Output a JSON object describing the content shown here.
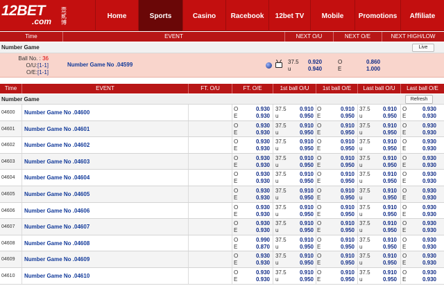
{
  "brand": {
    "logo_text": "12BET",
    "logo_sub": ".com",
    "logo_cn": "壹貳博"
  },
  "nav": {
    "items": [
      {
        "label": "Home",
        "active": false
      },
      {
        "label": "Sports",
        "active": true
      },
      {
        "label": "Casino",
        "active": false
      },
      {
        "label": "Racebook",
        "active": false
      },
      {
        "label": "12bet TV",
        "active": false
      },
      {
        "label": "Mobile",
        "active": false
      },
      {
        "label": "Promotions",
        "active": false
      },
      {
        "label": "Affiliate",
        "active": false
      }
    ]
  },
  "live": {
    "headers": {
      "time": "Time",
      "event": "EVENT",
      "next_ou": "NEXT O/U",
      "next_oe": "NEXT O/E",
      "next_highlow": "NEXT HIGH/LOW"
    },
    "league": "Number Game",
    "live_button": "Live",
    "ball_label": "Ball No. :",
    "ball_no": "36",
    "ou_label": "O/U:",
    "ou_value": "[1-1]",
    "oe_label": "O/E:",
    "oe_value": "[1-1]",
    "game": "Number Game No .04599",
    "line": "37.5",
    "under": "u",
    "over_odds": "0.920",
    "under_odds": "0.940",
    "odd_key": "O",
    "even_key": "E",
    "odd_odds": "0.860",
    "even_odds": "1.000"
  },
  "table": {
    "headers": {
      "time": "Time",
      "event": "EVENT",
      "ft_ou": "FT. O/U",
      "ft_oe": "FT. O/E",
      "first_ou": "1st ball O/U",
      "first_oe": "1st ball O/E",
      "last_ou": "Last ball O/U",
      "last_oe": "Last ball O/E"
    },
    "league": "Number Game",
    "refresh_button": "Refresh",
    "rows": [
      {
        "time": "04600",
        "event": "Number Game No .04600",
        "ft_o": "0.930",
        "ft_e": "0.930",
        "fb_line": "37.5",
        "fb_u": "u",
        "fb_ou1": "0.910",
        "fb_ou2": "0.950",
        "fb_oe1": "0.910",
        "fb_oe2": "0.950",
        "lb_line": "37.5",
        "lb_u": "u",
        "lb_ou1": "0.910",
        "lb_ou2": "0.950",
        "lb_oe1": "0.930",
        "lb_oe2": "0.930"
      },
      {
        "time": "04601",
        "event": "Number Game No .04601",
        "ft_o": "0.930",
        "ft_e": "0.930",
        "fb_line": "37.5",
        "fb_u": "u",
        "fb_ou1": "0.910",
        "fb_ou2": "0.950",
        "fb_oe1": "0.910",
        "fb_oe2": "0.950",
        "lb_line": "37.5",
        "lb_u": "u",
        "lb_ou1": "0.910",
        "lb_ou2": "0.950",
        "lb_oe1": "0.930",
        "lb_oe2": "0.930"
      },
      {
        "time": "04602",
        "event": "Number Game No .04602",
        "ft_o": "0.930",
        "ft_e": "0.930",
        "fb_line": "37.5",
        "fb_u": "u",
        "fb_ou1": "0.910",
        "fb_ou2": "0.950",
        "fb_oe1": "0.910",
        "fb_oe2": "0.950",
        "lb_line": "37.5",
        "lb_u": "u",
        "lb_ou1": "0.910",
        "lb_ou2": "0.950",
        "lb_oe1": "0.930",
        "lb_oe2": "0.930"
      },
      {
        "time": "04603",
        "event": "Number Game No .04603",
        "ft_o": "0.930",
        "ft_e": "0.930",
        "fb_line": "37.5",
        "fb_u": "u",
        "fb_ou1": "0.910",
        "fb_ou2": "0.950",
        "fb_oe1": "0.910",
        "fb_oe2": "0.950",
        "lb_line": "37.5",
        "lb_u": "u",
        "lb_ou1": "0.910",
        "lb_ou2": "0.950",
        "lb_oe1": "0.930",
        "lb_oe2": "0.930"
      },
      {
        "time": "04604",
        "event": "Number Game No .04604",
        "ft_o": "0.930",
        "ft_e": "0.930",
        "fb_line": "37.5",
        "fb_u": "u",
        "fb_ou1": "0.910",
        "fb_ou2": "0.950",
        "fb_oe1": "0.910",
        "fb_oe2": "0.950",
        "lb_line": "37.5",
        "lb_u": "u",
        "lb_ou1": "0.910",
        "lb_ou2": "0.950",
        "lb_oe1": "0.930",
        "lb_oe2": "0.930"
      },
      {
        "time": "04605",
        "event": "Number Game No .04605",
        "ft_o": "0.930",
        "ft_e": "0.930",
        "fb_line": "37.5",
        "fb_u": "u",
        "fb_ou1": "0.910",
        "fb_ou2": "0.950",
        "fb_oe1": "0.910",
        "fb_oe2": "0.950",
        "lb_line": "37.5",
        "lb_u": "u",
        "lb_ou1": "0.910",
        "lb_ou2": "0.950",
        "lb_oe1": "0.930",
        "lb_oe2": "0.930"
      },
      {
        "time": "04606",
        "event": "Number Game No .04606",
        "ft_o": "0.930",
        "ft_e": "0.930",
        "fb_line": "37.5",
        "fb_u": "u",
        "fb_ou1": "0.910",
        "fb_ou2": "0.950",
        "fb_oe1": "0.910",
        "fb_oe2": "0.950",
        "lb_line": "37.5",
        "lb_u": "u",
        "lb_ou1": "0.910",
        "lb_ou2": "0.950",
        "lb_oe1": "0.930",
        "lb_oe2": "0.930"
      },
      {
        "time": "04607",
        "event": "Number Game No .04607",
        "ft_o": "0.930",
        "ft_e": "0.930",
        "fb_line": "37.5",
        "fb_u": "u",
        "fb_ou1": "0.910",
        "fb_ou2": "0.950",
        "fb_oe1": "0.910",
        "fb_oe2": "0.950",
        "lb_line": "37.5",
        "lb_u": "u",
        "lb_ou1": "0.910",
        "lb_ou2": "0.950",
        "lb_oe1": "0.930",
        "lb_oe2": "0.930"
      },
      {
        "time": "04608",
        "event": "Number Game No .04608",
        "ft_o": "0.990",
        "ft_e": "0.870",
        "fb_line": "37.5",
        "fb_u": "u",
        "fb_ou1": "0.910",
        "fb_ou2": "0.950",
        "fb_oe1": "0.910",
        "fb_oe2": "0.950",
        "lb_line": "37.5",
        "lb_u": "u",
        "lb_ou1": "0.910",
        "lb_ou2": "0.950",
        "lb_oe1": "0.930",
        "lb_oe2": "0.930"
      },
      {
        "time": "04609",
        "event": "Number Game No .04609",
        "ft_o": "0.930",
        "ft_e": "0.930",
        "fb_line": "37.5",
        "fb_u": "u",
        "fb_ou1": "0.910",
        "fb_ou2": "0.950",
        "fb_oe1": "0.910",
        "fb_oe2": "0.950",
        "lb_line": "37.5",
        "lb_u": "u",
        "lb_ou1": "0.910",
        "lb_ou2": "0.950",
        "lb_oe1": "0.930",
        "lb_oe2": "0.930"
      },
      {
        "time": "04610",
        "event": "Number Game No .04610",
        "ft_o": "0.930",
        "ft_e": "0.930",
        "fb_line": "37.5",
        "fb_u": "u",
        "fb_ou1": "0.910",
        "fb_ou2": "0.950",
        "fb_oe1": "0.910",
        "fb_oe2": "0.950",
        "lb_line": "37.5",
        "lb_u": "u",
        "lb_ou1": "0.910",
        "lb_ou2": "0.950",
        "lb_oe1": "0.930",
        "lb_oe2": "0.930"
      }
    ]
  },
  "colors": {
    "brand_red": "#c30f0f",
    "header_red": "#b81616",
    "live_row": "#f9d5cc",
    "link_blue": "#123a9a",
    "odds_blue": "#112d88"
  }
}
